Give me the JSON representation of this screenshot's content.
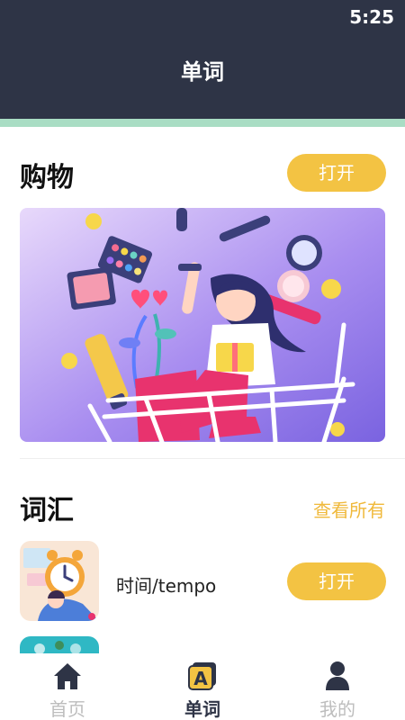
{
  "status_bar": {
    "time": "5:25"
  },
  "header": {
    "title": "单词"
  },
  "shopping": {
    "title": "购物",
    "open_label": "打开"
  },
  "vocabulary": {
    "title": "词汇",
    "view_all_label": "查看所有",
    "items": [
      {
        "label": "时间/tempo",
        "open_label": "打开"
      }
    ]
  },
  "tabs": [
    {
      "label": "首页",
      "icon": "home-icon",
      "active": false
    },
    {
      "label": "单词",
      "icon": "letter-a-icon",
      "active": true
    },
    {
      "label": "我的",
      "icon": "user-icon",
      "active": false
    }
  ],
  "colors": {
    "header_bg": "#2e3446",
    "accent_strip": "#a9ddc4",
    "button_yellow": "#f3c343",
    "link_yellow": "#f0b93b",
    "active_tab": "#2e3446",
    "inactive_tab": "#bdbdbd"
  }
}
